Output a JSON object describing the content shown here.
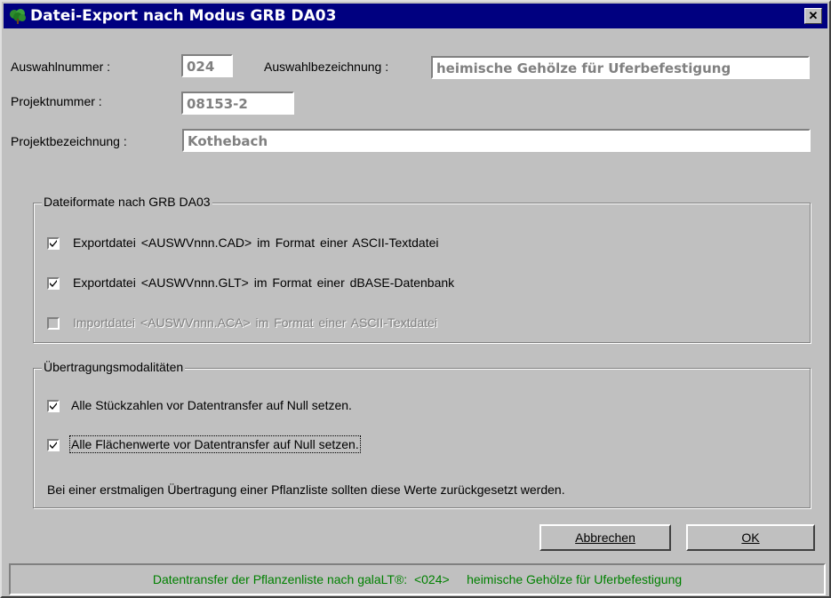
{
  "window": {
    "title": "Datei-Export nach Modus GRB DA03",
    "close_label": "✕",
    "title_color": "#000080"
  },
  "fields": {
    "auswahlnummer_label": "Auswahlnummer :",
    "auswahlnummer_value": "024",
    "auswahlbezeichnung_label": "Auswahlbezeichnung :",
    "auswahlbezeichnung_value": "heimische Gehölze für Uferbefestigung",
    "projektnummer_label": "Projektnummer :",
    "projektnummer_value": "08153-2",
    "projektbezeichnung_label": "Projektbezeichnung :",
    "projektbezeichnung_value": "Kothebach"
  },
  "dateiformate": {
    "legend": "Dateiformate nach GRB DA03",
    "items": [
      {
        "label": "Exportdatei  <AUSWVnnn.CAD>   im Format einer ASCII-Textdatei",
        "checked": true,
        "enabled": true
      },
      {
        "label": "Exportdatei  <AUSWVnnn.GLT>   im Format einer dBASE-Datenbank",
        "checked": true,
        "enabled": true
      },
      {
        "label": "Importdatei  <AUSWVnnn.ACA>   im Format einer ASCII-Textdatei",
        "checked": false,
        "enabled": false
      }
    ]
  },
  "uebertragung": {
    "legend": "Übertragungsmodalitäten",
    "items": [
      {
        "label": "Alle Stückzahlen vor Datentransfer auf Null setzen.",
        "checked": true
      },
      {
        "label": "Alle Flächenwerte vor Datentransfer auf Null setzen.",
        "checked": true
      }
    ],
    "note": "Bei einer erstmaligen Übertragung einer Pflanzliste sollten diese Werte zurückgesetzt werden."
  },
  "buttons": {
    "cancel_label": "Abbrechen",
    "ok_label": "OK"
  },
  "status": {
    "text": "Datentransfer der Pflanzenliste nach galaLT®:  <024>     heimische Gehölze für Uferbefestigung",
    "color": "#008000"
  }
}
